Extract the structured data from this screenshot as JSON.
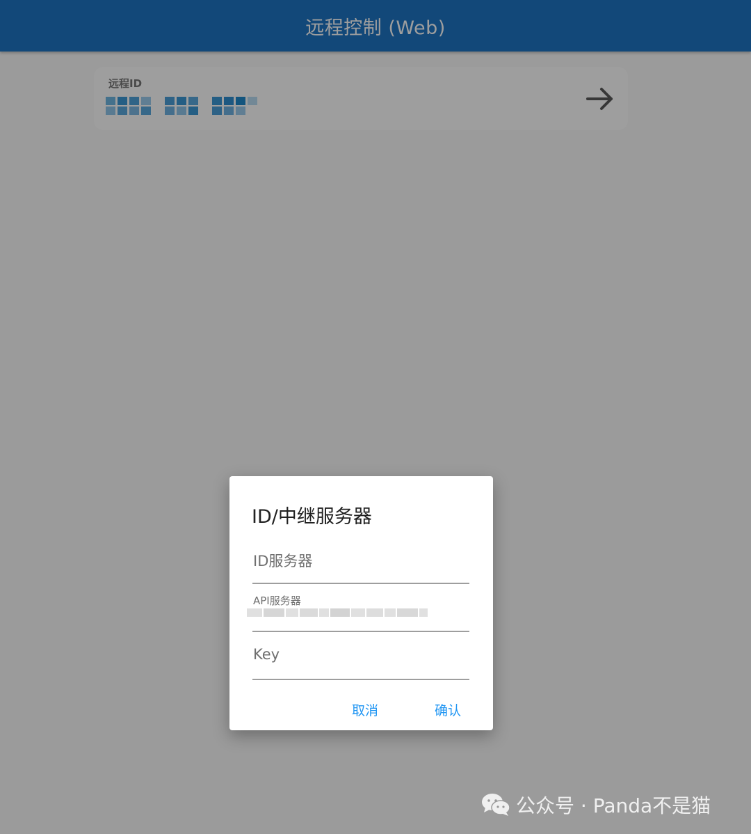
{
  "appbar": {
    "title": "远程控制 (Web)"
  },
  "remote_card": {
    "label": "远程ID",
    "value_obscured": true
  },
  "dialog": {
    "title": "ID/中继服务器",
    "fields": {
      "id_server_placeholder": "ID服务器",
      "api_server_label": "API服务器",
      "key_placeholder": "Key"
    },
    "buttons": {
      "cancel": "取消",
      "confirm": "确认"
    }
  },
  "watermark": {
    "text": "公众号 · Panda不是猫"
  },
  "colors": {
    "appbar": "#1e74c4",
    "accent": "#2196f3",
    "scrim": "rgba(0,0,0,0.38)"
  },
  "icons": {
    "arrow": "arrow-right-icon",
    "watermark": "wechat-icon"
  }
}
